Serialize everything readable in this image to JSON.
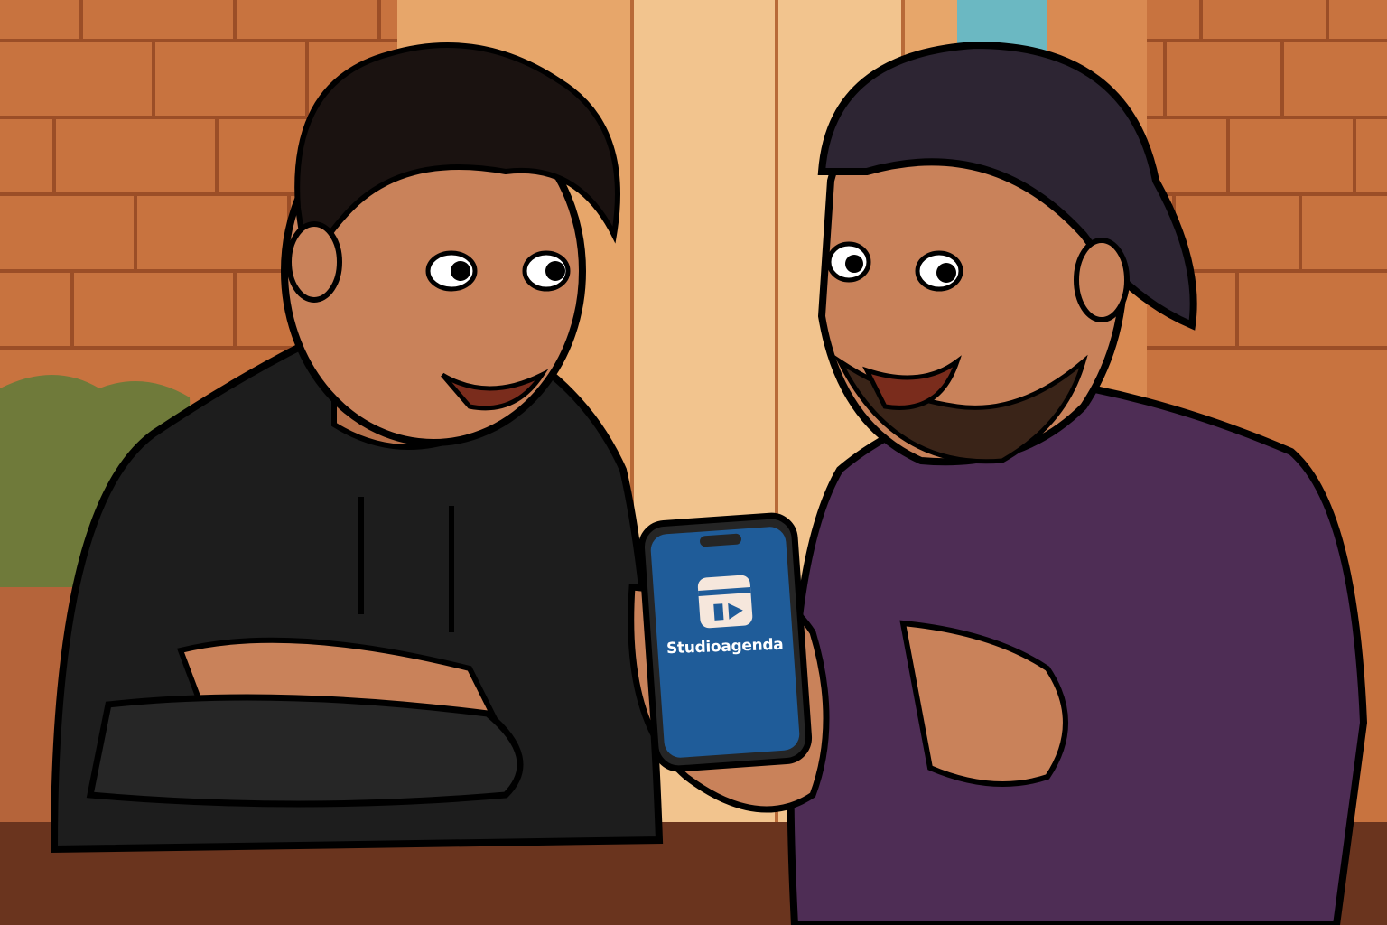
{
  "scene": {
    "description_free": true,
    "phone": {
      "app_name": "Studioagenda",
      "icon": "calendar-play-icon",
      "screen_color": "#1f5c99",
      "icon_bg_color": "#f6e7dc"
    },
    "colors": {
      "brick_wall": "#c8733f",
      "window_frame": "#f2c48e",
      "hoodie": "#1d1d1d",
      "tshirt": "#4e2d55",
      "cap": "#2d2533",
      "skin": "#c9825a",
      "table": "#6a341e"
    }
  }
}
